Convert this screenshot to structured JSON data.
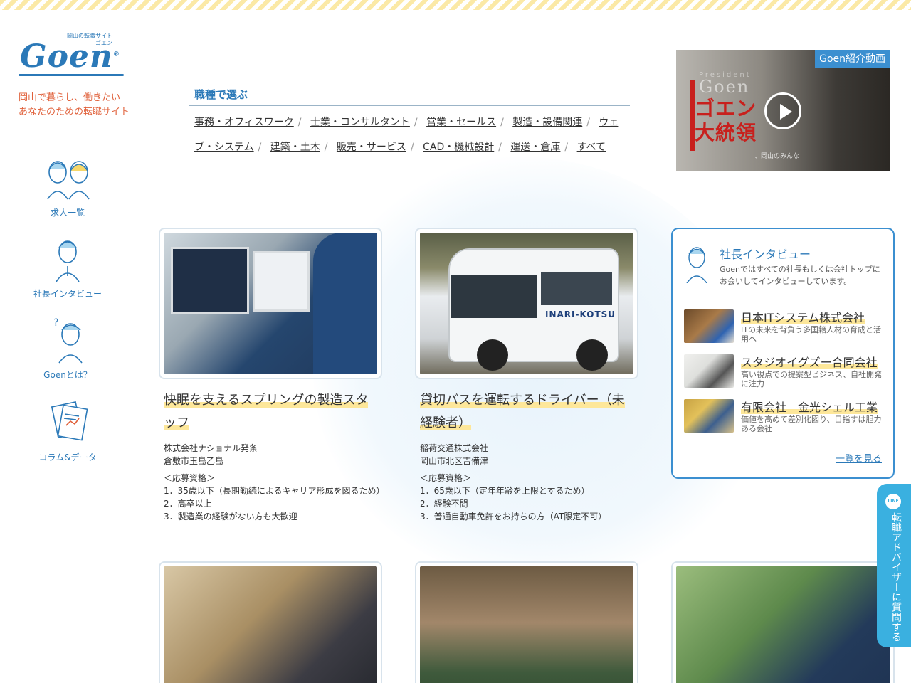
{
  "logo": {
    "small": "岡山の転職サイト",
    "kana": "ゴエン",
    "word": "Goen",
    "reg": "®"
  },
  "tagline": [
    "岡山で暮らし、働きたい",
    "あなたのための転職サイト"
  ],
  "side_nav": [
    {
      "label": "求人一覧",
      "icon": "couple-icon"
    },
    {
      "label": "社長インタビュー",
      "icon": "president-icon"
    },
    {
      "label": "Goenとは？",
      "icon": "question-person-icon"
    },
    {
      "label": "コラム&データ",
      "icon": "document-chart-icon"
    }
  ],
  "category": {
    "title": "職種で選ぶ",
    "links": [
      "事務・オフィスワーク",
      "士業・コンサルタント",
      "営業・セールス",
      "製造・設備関連",
      "ウェブ・システム",
      "建築・土木",
      "販売・サービス",
      "CAD・機械設計",
      "運送・倉庫",
      "すべて"
    ]
  },
  "video": {
    "badge": "Goen紹介動画",
    "president": "President",
    "ghost": "Goen",
    "red_text": "ゴエン大統領",
    "caption": "、岡山のみんな",
    "icon": "play-icon"
  },
  "jobs": [
    {
      "title": "快眠を支えるスプリングの製造スタッフ",
      "company": "株式会社ナショナル発条",
      "location": "倉敷市玉島乙島",
      "req_heading": "＜応募資格＞",
      "requirements": [
        "1．35歳以下（長期勤続によるキャリア形成を図るため）",
        "2．高卒以上",
        "3．製造業の経験がない方も大歓迎"
      ]
    },
    {
      "title": "貸切バスを運転するドライバー（未経験者）",
      "company": "稲荷交通株式会社",
      "location": "岡山市北区吉備津",
      "req_heading": "＜応募資格＞",
      "requirements": [
        "1．65歳以下（定年年齢を上限とするため）",
        "2．経験不問",
        "3．普通自動車免許をお持ちの方（AT限定不可）"
      ],
      "photo_text": "INARI-KOTSU"
    }
  ],
  "interview": {
    "title": "社長インタビュー",
    "desc": "Goenではすべての社長もしくは会社トップにお会いしてインタビューしています。",
    "items": [
      {
        "name": "日本ITシステム株式会社",
        "sub": "ITの未来を背負う多国籍人材の育成と活用へ"
      },
      {
        "name": "スタジオイグズー合同会社",
        "sub": "高い視点での提案型ビジネス、自社開発に注力"
      },
      {
        "name": "有限会社　金光シェル工業",
        "sub": "価値を高めて差別化図り、目指すは胆力ある会社"
      }
    ],
    "more": "一覧を見る"
  },
  "line_tab": {
    "badge": "LINE",
    "text": "転職アドバイザーに質問する"
  }
}
